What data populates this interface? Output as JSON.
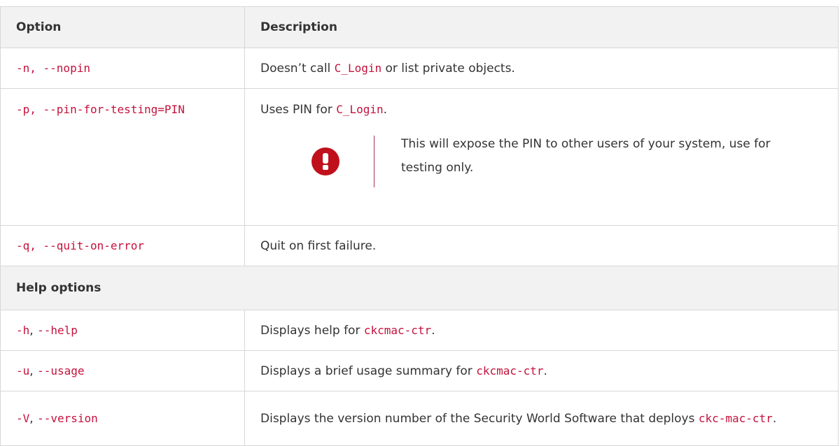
{
  "header": {
    "option": "Option",
    "description": "Description"
  },
  "rows": [
    {
      "option": "-n, --nopin",
      "desc_pre": "Doesn’t call ",
      "desc_code": "C_Login",
      "desc_post": " or list private objects."
    },
    {
      "option": "-p, --pin-for-testing=PIN",
      "desc_pre": "Uses PIN for ",
      "desc_code": "C_Login",
      "desc_post": ".",
      "warning": {
        "icon": "exclamation-icon",
        "color": "#c0101b",
        "text": "This will expose the PIN to other users of your system, use for testing only."
      }
    },
    {
      "option": "-q, --quit-on-error",
      "desc": "Quit on first failure."
    }
  ],
  "section": "Help options",
  "help_rows": [
    {
      "opt_a": "-h",
      "sep": ", ",
      "opt_b": "--help",
      "desc_pre": "Displays help for ",
      "desc_code": "ckcmac-ctr",
      "desc_post": "."
    },
    {
      "opt_a": "-u",
      "sep": ", ",
      "opt_b": "--usage",
      "desc_pre": "Displays a brief usage summary for ",
      "desc_code": "ckcmac-ctr",
      "desc_post": "."
    },
    {
      "opt_a": "-V",
      "sep": ", ",
      "opt_b": "--version",
      "desc_pre": "Displays the version number of the Security World Software that deploys ",
      "desc_code": "ckc-mac-ctr",
      "desc_post": "."
    }
  ],
  "colors": {
    "code": "#c4123c",
    "header_bg": "#f2f2f2",
    "border": "#d7d7d7"
  }
}
